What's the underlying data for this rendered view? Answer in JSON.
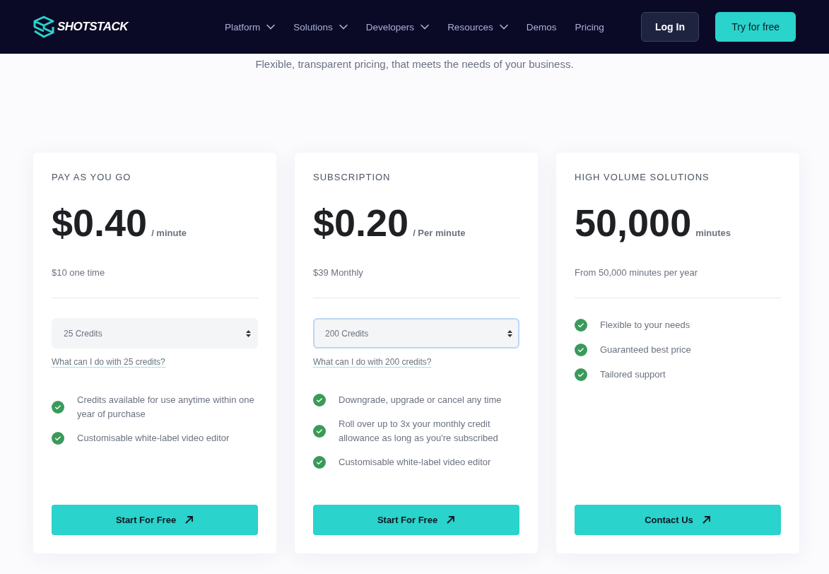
{
  "header": {
    "brand": "SHOTSTACK",
    "nav": [
      {
        "label": "Platform",
        "dropdown": true
      },
      {
        "label": "Solutions",
        "dropdown": true
      },
      {
        "label": "Developers",
        "dropdown": true
      },
      {
        "label": "Resources",
        "dropdown": true
      },
      {
        "label": "Demos",
        "dropdown": false
      },
      {
        "label": "Pricing",
        "dropdown": false
      }
    ],
    "login": "Log In",
    "cta": "Try for free"
  },
  "subtitle": "Flexible, transparent pricing, that meets the needs of your business.",
  "plans": [
    {
      "tag": "PAY AS YOU GO",
      "price": "$0.40",
      "unit": "/ minute",
      "note": "$10 one time",
      "select": {
        "value": "25 Credits",
        "focused": false
      },
      "link": "What can I do with 25 credits?",
      "features": [
        "Credits available for use anytime within one year of purchase",
        "Customisable white-label video editor"
      ],
      "button": "Start For Free"
    },
    {
      "tag": "SUBSCRIPTION",
      "price": "$0.20",
      "unit": "/ Per minute",
      "note": "$39 Monthly",
      "select": {
        "value": "200 Credits",
        "focused": true
      },
      "link": "What can I do with 200 credits?",
      "features": [
        "Downgrade, upgrade or cancel any time",
        "Roll over up to 3x your monthly credit allowance as long as you're subscribed",
        "Customisable white-label video editor"
      ],
      "button": "Start For Free"
    },
    {
      "tag": "HIGH VOLUME SOLUTIONS",
      "price": "50,000",
      "unit": "minutes",
      "note": "From 50,000 minutes per year",
      "features": [
        "Flexible to your needs",
        "Guaranteed best price",
        "Tailored support"
      ],
      "button": "Contact Us"
    }
  ]
}
